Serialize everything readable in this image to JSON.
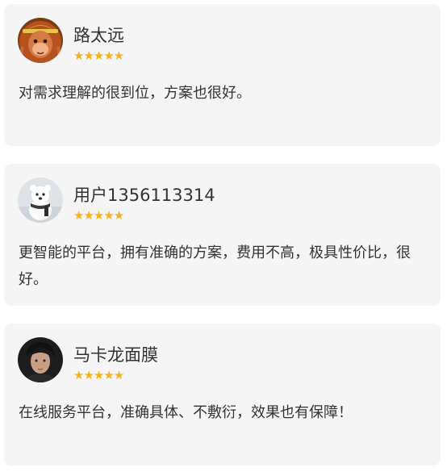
{
  "reviews": [
    {
      "username": "路太远",
      "rating": 5,
      "stars": "★★★★★",
      "comment": "对需求理解的很到位，方案也很好。"
    },
    {
      "username": "用户1356113314",
      "rating": 5,
      "stars": "★★★★★",
      "comment": "更智能的平台，拥有准确的方案，费用不高，极具性价比，很好。"
    },
    {
      "username": "马卡龙面膜",
      "rating": 5,
      "stars": "★★★★★",
      "comment": "在线服务平台，准确具体、不敷衍，效果也有保障！"
    }
  ],
  "colors": {
    "card_background": "#f5f5f5",
    "star": "#f6b21b",
    "text": "#333333"
  }
}
